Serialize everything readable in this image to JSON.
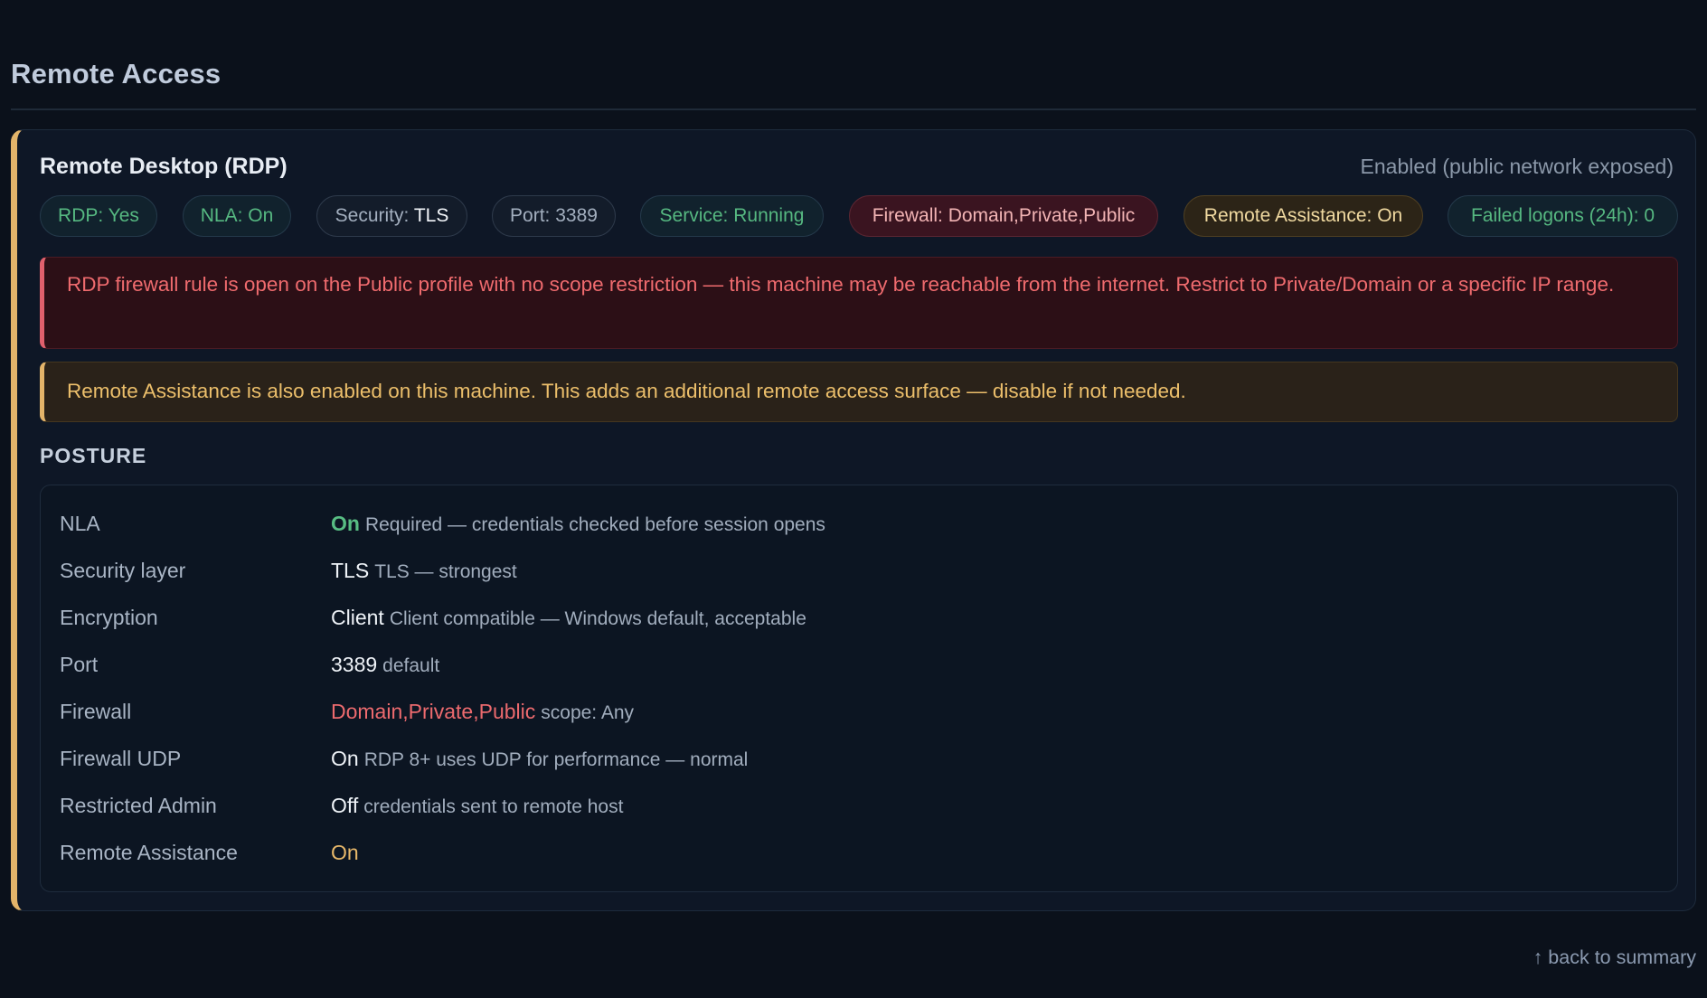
{
  "section": {
    "title": "Remote Access"
  },
  "rdp_card": {
    "title": "Remote Desktop (RDP)",
    "status": "Enabled (public network exposed)",
    "chips": [
      {
        "name": "chip-rdp",
        "text": "RDP: Yes",
        "tone": "green"
      },
      {
        "name": "chip-nla",
        "text": "NLA: On",
        "tone": "green"
      },
      {
        "name": "chip-security",
        "prefix": "Security: ",
        "strong": "TLS",
        "tone": "grey"
      },
      {
        "name": "chip-port",
        "text": "Port: 3389",
        "tone": "grey"
      },
      {
        "name": "chip-service",
        "text": "Service: Running",
        "tone": "green"
      },
      {
        "name": "chip-firewall",
        "text": "Firewall: Domain,Private,Public",
        "tone": "red"
      },
      {
        "name": "chip-remote-assistance",
        "text": "Remote Assistance: On",
        "tone": "amber"
      },
      {
        "name": "chip-failed-logons",
        "text": "Failed logons (24h): 0",
        "tone": "green"
      }
    ],
    "alerts": {
      "danger": "RDP firewall rule is open on the Public profile with no scope restriction — this machine may be reachable from the internet. Restrict to Private/Domain or a specific IP range.",
      "warning": "Remote Assistance is also enabled on this machine. This adds an additional remote access surface — disable if not needed."
    },
    "posture": {
      "heading": "POSTURE",
      "rows": [
        {
          "label": "NLA",
          "value": "On",
          "note": "Required — credentials checked before session opens",
          "tone": "green"
        },
        {
          "label": "Security layer",
          "value": "TLS",
          "note": "TLS — strongest",
          "tone": "plain"
        },
        {
          "label": "Encryption",
          "value": "Client",
          "note": "Client compatible — Windows default, acceptable",
          "tone": "plain"
        },
        {
          "label": "Port",
          "value": "3389",
          "note": "default",
          "tone": "plain"
        },
        {
          "label": "Firewall",
          "value": "Domain,Private,Public",
          "note": "scope: Any",
          "tone": "red"
        },
        {
          "label": "Firewall UDP",
          "value": "On",
          "note": "RDP 8+ uses UDP for performance — normal",
          "tone": "plain"
        },
        {
          "label": "Restricted Admin",
          "value": "Off",
          "note": "credentials sent to remote host",
          "tone": "plain"
        },
        {
          "label": "Remote Assistance",
          "value": "On",
          "note": "",
          "tone": "amber"
        }
      ]
    }
  },
  "footer": {
    "back_link": "↑ back to summary"
  },
  "colors": {
    "background": "#0b111b",
    "card_accent": "#e3b46a",
    "ok_green": "#58bd83",
    "danger_red": "#ec6a6e",
    "warning_amber": "#e8b86a"
  }
}
